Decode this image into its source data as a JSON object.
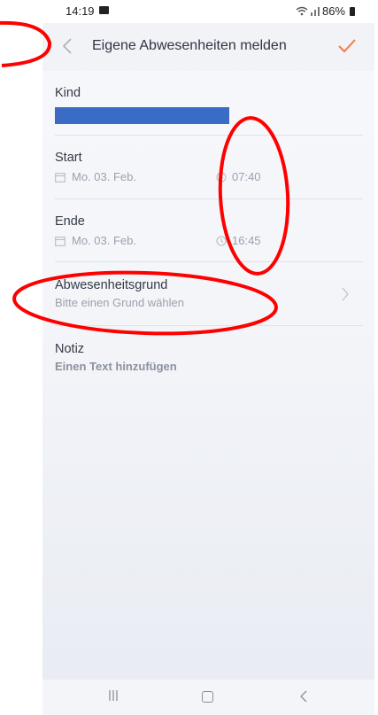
{
  "status_bar": {
    "time": "14:19",
    "battery": "86%"
  },
  "header": {
    "title": "Eigene Abwesenheiten melden"
  },
  "form": {
    "kind": {
      "label": "Kind"
    },
    "start": {
      "label": "Start",
      "date": "Mo. 03. Feb.",
      "time": "07:40"
    },
    "ende": {
      "label": "Ende",
      "date": "Mo. 03. Feb.",
      "time": "16:45"
    },
    "grund": {
      "label": "Abwesenheitsgrund",
      "placeholder": "Bitte einen Grund wählen"
    },
    "notiz": {
      "label": "Notiz",
      "placeholder": "Einen Text hinzufügen"
    }
  },
  "colors": {
    "accent": "#f07a4a",
    "redaction": "#3a6bc5",
    "annotation": "#ff0000",
    "muted_text": "#9aa1ad"
  },
  "icons": [
    "gallery-icon",
    "wifi-icon",
    "signal-icon",
    "battery-icon",
    "back-icon",
    "check-icon",
    "calendar-icon",
    "clock-icon",
    "chevron-right-icon",
    "recent-apps-icon",
    "home-icon",
    "nav-back-icon"
  ]
}
